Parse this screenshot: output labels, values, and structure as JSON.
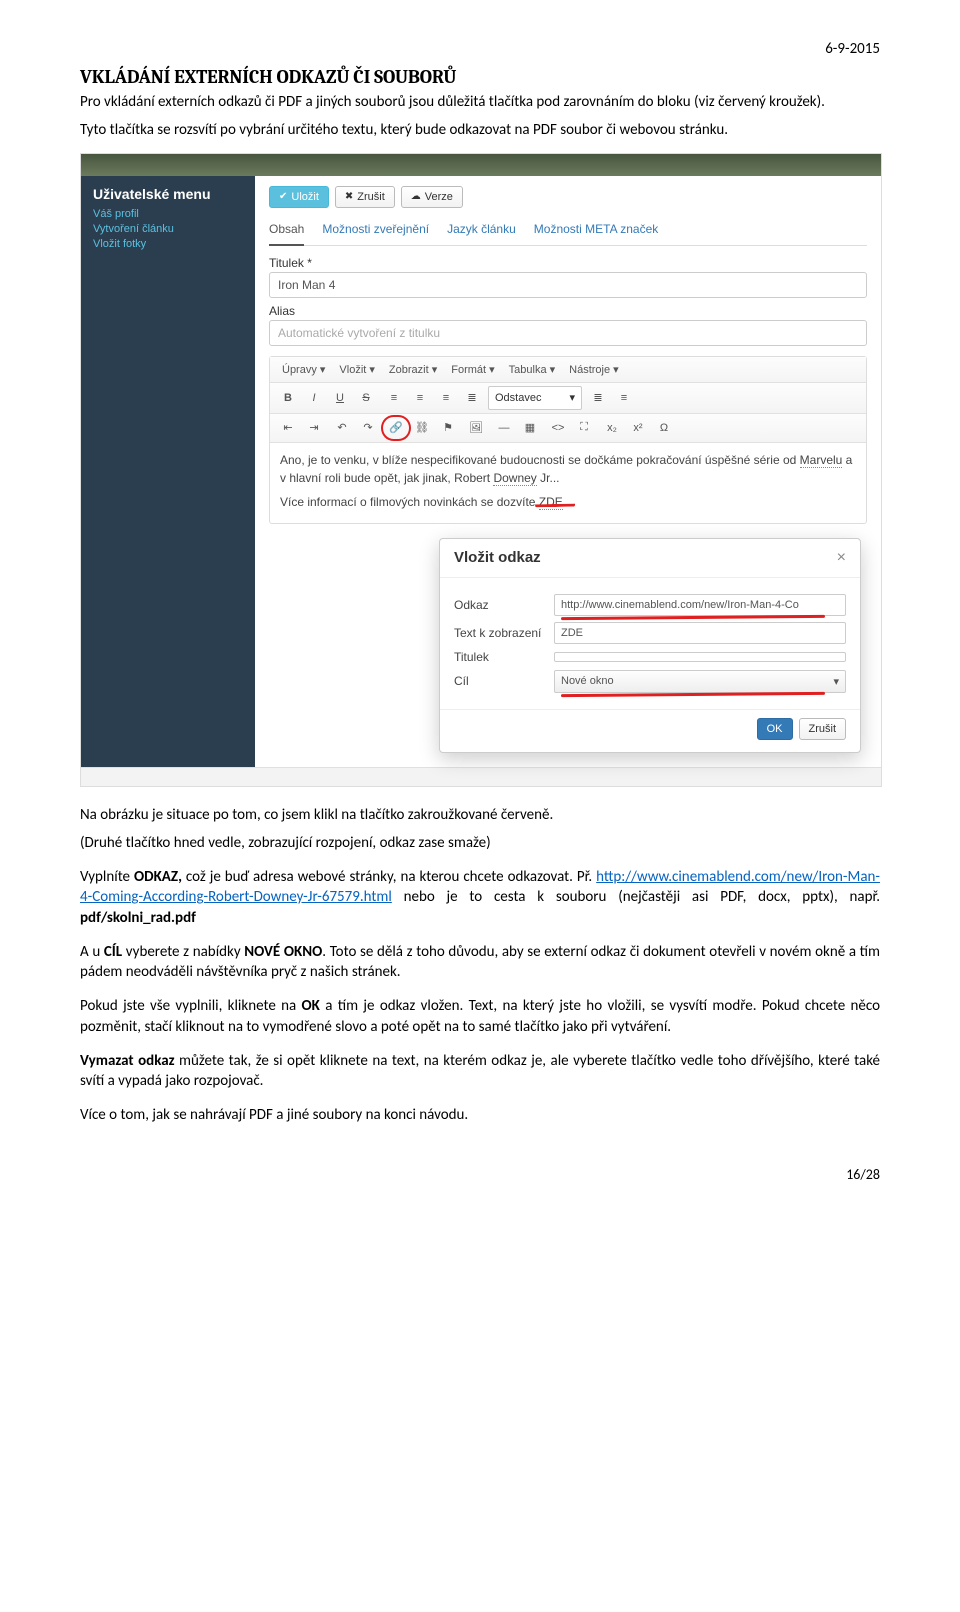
{
  "date": "6-9-2015",
  "title": "VKLÁDÁNÍ EXTERNÍCH ODKAZŮ ČI SOUBORŮ",
  "p1": "Pro vkládání externích odkazů či PDF a jiných souborů jsou důležitá tlačítka pod zarovnáním do bloku (viz červený kroužek).",
  "p2": "Tyto tlačítka se rozsvítí po vybrání určitého textu, který bude odkazovat na PDF soubor či webovou stránku.",
  "p3": "Na obrázku je situace po tom, co jsem klikl na tlačítko zakroužkované červeně.",
  "p4": "(Druhé tlačítko hned vedle, zobrazující rozpojení, odkaz zase smaže)",
  "p5a": "Vyplníte ",
  "p5b": "ODKAZ,",
  "p5c": " což je buď adresa webové stránky, na kterou chcete odkazovat. Př. ",
  "p5link": "http://www.cinemablend.com/new/Iron-Man-4-Coming-According-Robert-Downey-Jr-67579.html",
  "p5d": " nebo je to cesta k souboru (nejčastěji asi PDF, docx, pptx), např. ",
  "p5e": "pdf/skolni_rad.pdf",
  "p6a": "A u ",
  "p6b": "CÍL",
  "p6c": " vyberete z nabídky ",
  "p6d": "NOVÉ OKNO",
  "p6e": ". Toto se dělá z toho důvodu, aby se externí odkaz či dokument otevřeli v novém okně a tím pádem neodváděli návštěvníka pryč z našich stránek.",
  "p7a": "Pokud jste vše vyplnili, kliknete na ",
  "p7b": "OK",
  "p7c": " a tím je odkaz vložen. Text, na který jste ho vložili, se vysvítí modře. Pokud chcete něco pozměnit, stačí kliknout na to vymodřené slovo a poté opět na to samé tlačítko jako při vytváření.",
  "p8a": "Vymazat odkaz",
  "p8b": " můžete tak, že si opět kliknete na text, na kterém odkaz je, ale vyberete tlačítko vedle toho dřívějšího, které také svítí a vypadá jako rozpojovač.",
  "p9": "Více o tom, jak se nahrávají PDF a jiné soubory na konci návodu.",
  "pagenum": "16/28",
  "screenshot": {
    "sidebar": {
      "title": "Uživatelské menu",
      "items": [
        "Váš profil",
        "Vytvoření článku",
        "Vložit fotky"
      ]
    },
    "buttons": {
      "save": "Uložit",
      "cancel": "Zrušit",
      "versions": "Verze"
    },
    "tabs": [
      "Obsah",
      "Možnosti zveřejnění",
      "Jazyk článku",
      "Možnosti META značek"
    ],
    "form": {
      "title_label": "Titulek *",
      "title_value": "Iron Man 4",
      "alias_label": "Alias",
      "alias_placeholder": "Automatické vytvoření z titulku"
    },
    "editor_menus": [
      "Úpravy",
      "Vložit",
      "Zobrazit",
      "Formát",
      "Tabulka",
      "Nástroje"
    ],
    "format_select": "Odstavec",
    "content": {
      "line1a": "Ano, je to venku, v blíže nespecifikované budoucnosti se dočkáme pokračování úspěšné série od ",
      "marvelu": "Marvelu",
      "line1b": " a v hlavní roli bude opět, jak jinak, Robert ",
      "downey": "Downey",
      "line1c": " Jr...",
      "line2a": "Více informací o filmových novinkách se dozvíte ",
      "zde": "ZDE",
      "line2b": "."
    },
    "dialog": {
      "title": "Vložit odkaz",
      "fields": {
        "url_label": "Odkaz",
        "url_value": "http://www.cinemablend.com/new/Iron-Man-4-Co",
        "text_label": "Text k zobrazení",
        "text_value": "ZDE",
        "title_label": "Titulek",
        "title_value": "",
        "target_label": "Cíl",
        "target_value": "Nové okno"
      },
      "ok": "OK",
      "cancel": "Zrušit"
    }
  }
}
